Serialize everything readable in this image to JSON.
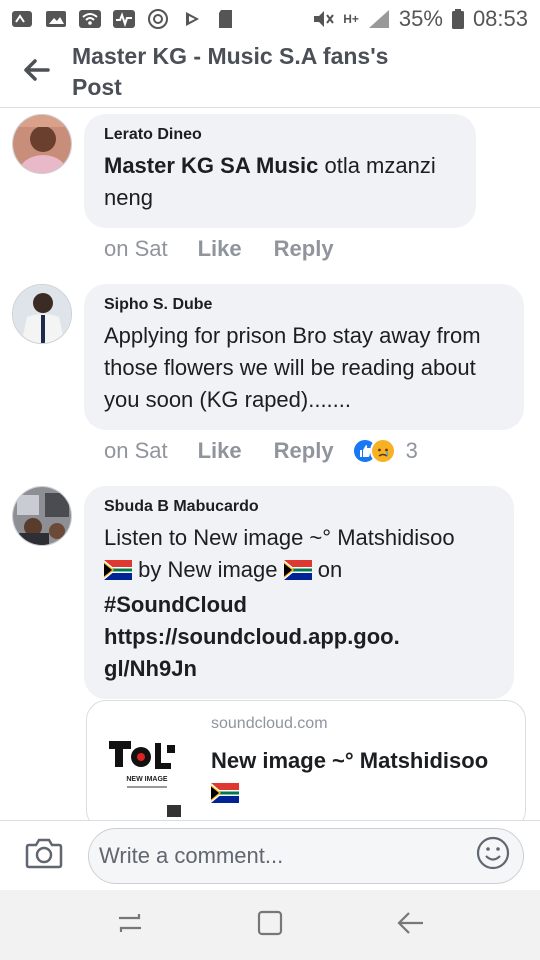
{
  "status_bar": {
    "battery": "35%",
    "time": "08:53",
    "network": "H+",
    "icons": [
      "sim-icon",
      "image-icon",
      "wifi-icon",
      "activity-icon",
      "camera-circle-icon",
      "play-icon",
      "sd-card-icon",
      "mute-icon",
      "signal-icon",
      "battery-icon"
    ]
  },
  "header": {
    "title": "Master KG - Music S.A fans's Post",
    "back_icon": "arrow-left-icon"
  },
  "comments": [
    {
      "author": "Lerato Dineo",
      "mention": "Master KG SA Music",
      "text": " otla mzanzi neng",
      "time": "on Sat",
      "like": "Like",
      "reply": "Reply"
    },
    {
      "author": "Sipho S. Dube",
      "text": "Applying for prison Bro stay away from those flowers we will be reading about you soon (KG raped).......",
      "time": "on Sat",
      "like": "Like",
      "reply": "Reply",
      "reaction_count": "3",
      "reactions": [
        "like-reaction-icon",
        "sad-reaction-icon"
      ]
    },
    {
      "author": "Sbuda B Mabucardo",
      "text_line1": "Listen to New image ~° Matshidisoo",
      "text_line2_a": " by New image ",
      "text_line2_b": " on",
      "hashtag": "#SoundCloud",
      "link": "https://soundcloud.app.goo.gl/Nh9Jn",
      "link_line1": "https://soundcloud.app.goo.",
      "link_line2": "gl/Nh9Jn",
      "flag_icon": "south-africa-flag-icon"
    }
  ],
  "link_preview": {
    "domain": "soundcloud.com",
    "title": "New image ~° Matshidisoo",
    "thumb_caption": "NEW IMAGE"
  },
  "composer": {
    "placeholder": "Write a comment...",
    "camera_icon": "camera-icon",
    "emoji_icon": "smiley-icon"
  },
  "nav": {
    "icons": [
      "recent-apps-icon",
      "home-icon",
      "back-icon"
    ]
  },
  "colors": {
    "bubble": "#f0f2f5",
    "meta": "#90949c",
    "header_title": "#4b4f56",
    "like_reaction": "#1877f2",
    "sad_reaction": "#f7b125"
  }
}
